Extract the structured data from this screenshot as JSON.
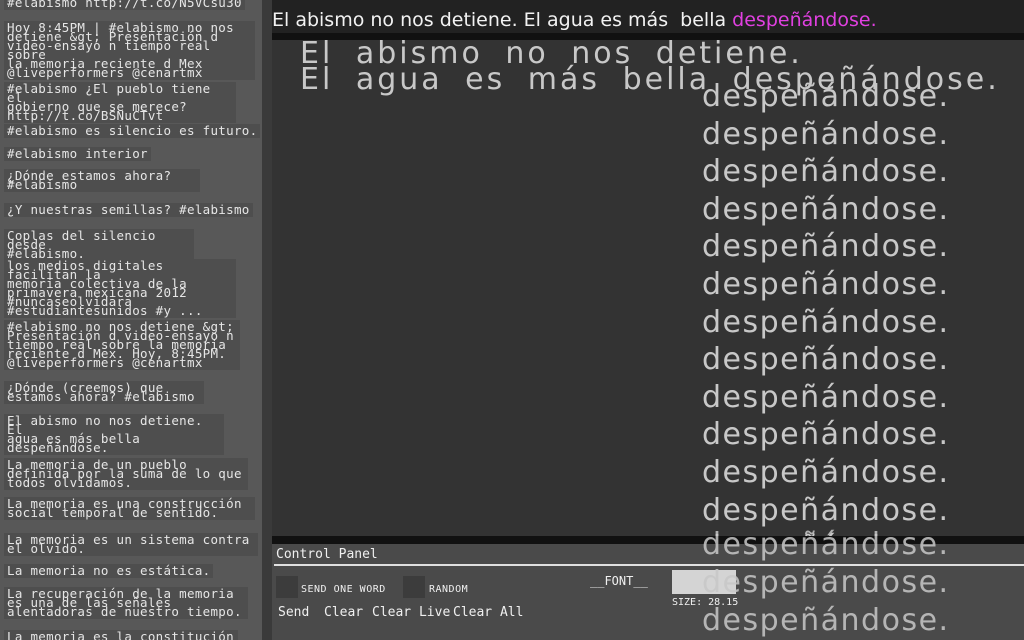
{
  "top_line": {
    "text": "El abismo no nos detiene. El agua es más  bella ",
    "highlight": "despeñándose."
  },
  "stage": {
    "line1": "El abismo no nos detiene.",
    "line2": "El agua es más bella despeñándose.",
    "repeat_word": "despeñándose."
  },
  "tweets": [
    "#elabismo http://t.co/N5VCsu30",
    "Hoy 8:45PM | #elabismo no nos\ndetiene &gt; Presentación d\nvideo-ensayo n tiempo real sobre\nla memoria reciente d Mex\n@liveperformers @cenartmx",
    "#elabismo ¿El pueblo tiene el\ngobierno que se merece?\nhttp://t.co/BSNuCTvt",
    "#elabismo es silencio es futuro.",
    "#elabismo interior",
    "¿Dónde estamos ahora?\n#elabismo",
    "¿Y nuestras semillas? #elabismo",
    "Coplas del silencio desde\n#elabismo.",
    "los medios digitales facilitan la\nmemoria colectiva de la\nprimavera mexicana 2012\n#nuncaseolvidara\n#estudiantesunidos #y ...",
    "#elabismo no nos detiene &gt;\nPresentación d video-ensayo n\ntiempo real sobre la memoria\nreciente d Mex. Hoy, 8:45PM.\n@liveperformers @cenartmx",
    "¿Dónde (creemos) que\nestamos ahora? #elabismo",
    "El abismo no nos detiene. El\nagua es más bella\ndespeñándose.",
    "La memoria de un pueblo\ndefinida por la suma de lo que\ntodos olvidamos.",
    "La memoria es una construcción\nsocial temporal de sentido.",
    "La memoria es un sistema contra\nel olvido.",
    "La memoria no es estática.",
    "La recuperación de la memoria\nes una de las señales\nalentadoras de nuestro tiempo.",
    "La memoria es la constitución"
  ],
  "panel": {
    "title": "Control Panel",
    "send_one_word": "SEND ONE WORD",
    "random": "RANDOM",
    "font_label": "__FONT__",
    "size_label": "SIZE: 28.15",
    "buttons": [
      "Send",
      "Clear",
      "Clear Live",
      "Clear All"
    ]
  }
}
